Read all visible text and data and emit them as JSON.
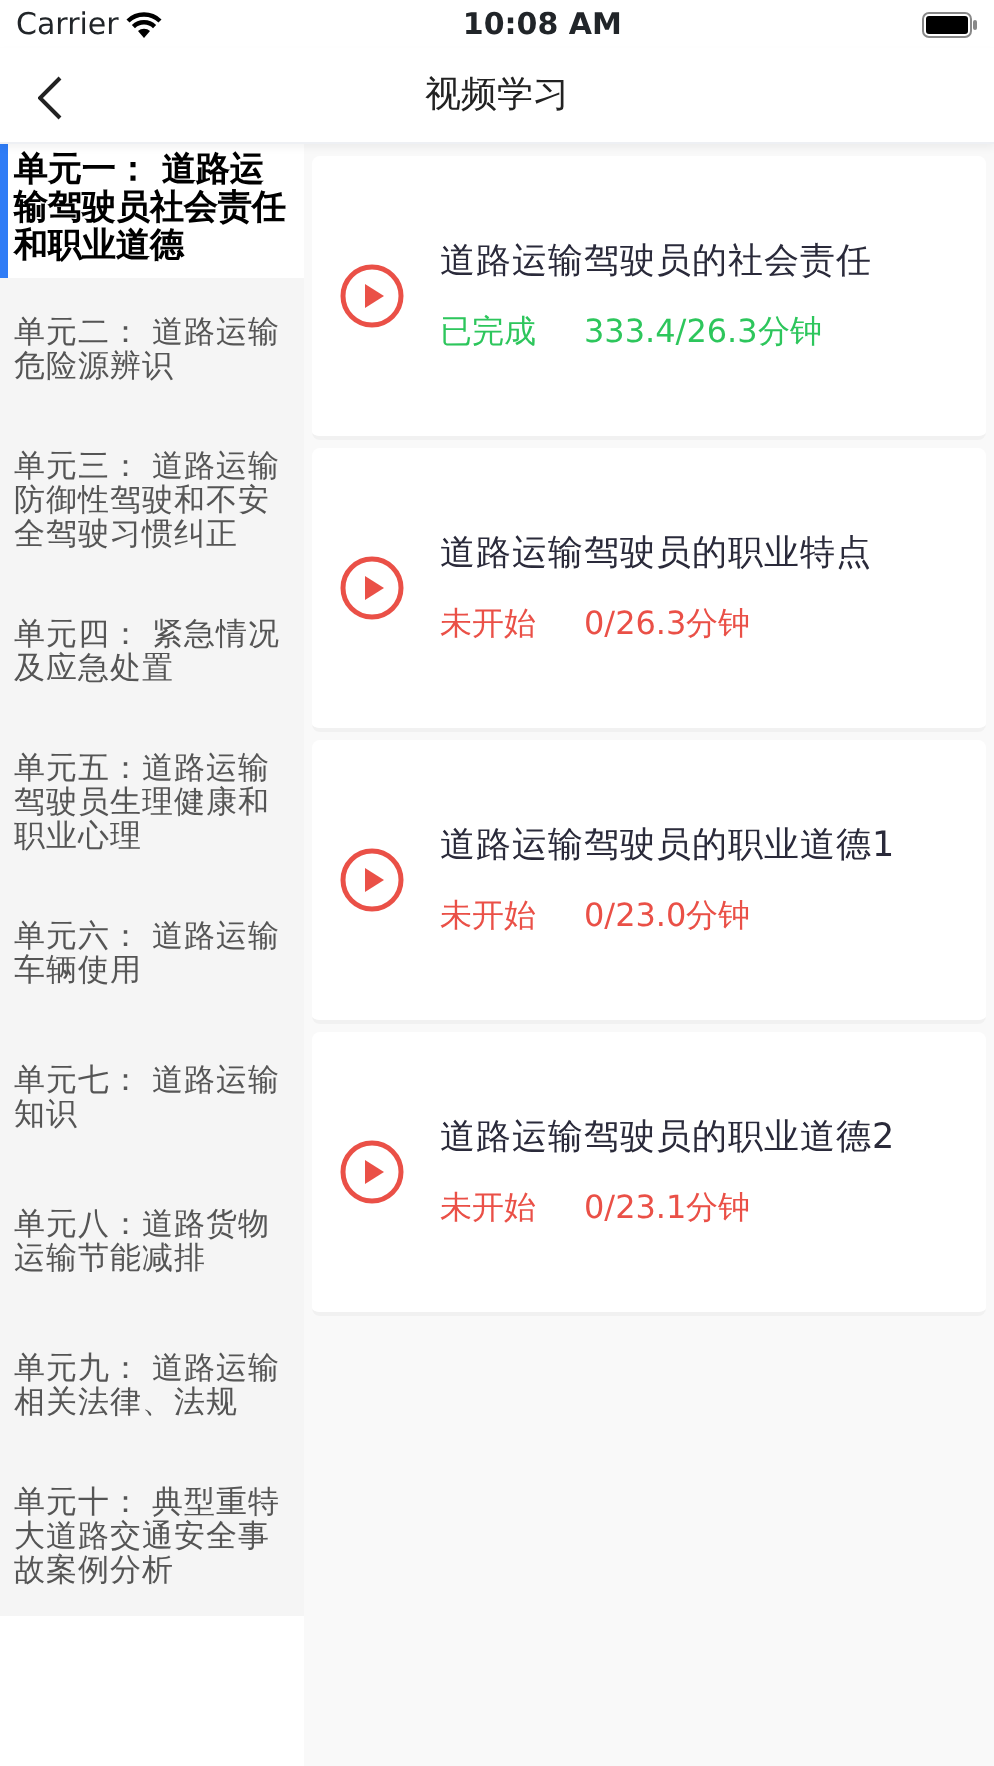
{
  "status_bar": {
    "carrier": "Carrier",
    "time": "10:08 AM"
  },
  "nav": {
    "title": "视频学习"
  },
  "units": [
    {
      "label": "单元一： 道路运输驾驶员社会责任和职业道德",
      "selected": true
    },
    {
      "label": "单元二： 道路运输危险源辨识",
      "selected": false
    },
    {
      "label": "单元三： 道路运输防御性驾驶和不安全驾驶习惯纠正",
      "selected": false
    },
    {
      "label": "单元四： 紧急情况及应急处置",
      "selected": false
    },
    {
      "label": "单元五：道路运输驾驶员生理健康和职业心理",
      "selected": false
    },
    {
      "label": "单元六： 道路运输车辆使用",
      "selected": false
    },
    {
      "label": "单元七： 道路运输知识",
      "selected": false
    },
    {
      "label": "单元八：道路货物运输节能减排",
      "selected": false
    },
    {
      "label": "单元九： 道路运输相关法律、法规",
      "selected": false
    },
    {
      "label": "单元十： 典型重特大道路交通安全事故案例分析",
      "selected": false
    }
  ],
  "videos": [
    {
      "title": "道路运输驾驶员的社会责任",
      "status": "已完成",
      "progress": "333.4/26.3分钟",
      "kind": "done"
    },
    {
      "title": "道路运输驾驶员的职业特点",
      "status": "未开始",
      "progress": "0/26.3分钟",
      "kind": "not_started"
    },
    {
      "title": "道路运输驾驶员的职业道德1",
      "status": "未开始",
      "progress": "0/23.0分钟",
      "kind": "not_started"
    },
    {
      "title": "道路运输驾驶员的职业道德2",
      "status": "未开始",
      "progress": "0/23.1分钟",
      "kind": "not_started"
    }
  ]
}
